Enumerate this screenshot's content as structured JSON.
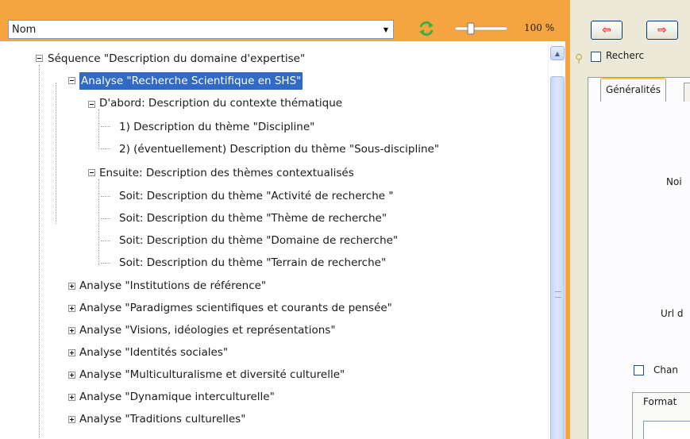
{
  "toolbar": {
    "field_value": "Nom",
    "zoom_value": "100 %"
  },
  "tree": {
    "root": "Séquence \"Description du domaine d'expertise\"",
    "selected": "Analyse \"Recherche Scientifique en SHS\"",
    "group1": "D'abord: Description du contexte thématique",
    "group1_items": [
      "1) Description du thème \"Discipline\"",
      "2) (éventuellement) Description du thème \"Sous-discipline\""
    ],
    "group2": "Ensuite: Description des thèmes contextualisés",
    "group2_items": [
      "Soit: Description du thème \"Activité de recherche \"",
      "Soit: Description du thème \"Thème de recherche\"",
      "Soit: Description du thème \"Domaine de recherche\"",
      "Soit: Description du thème \"Terrain de recherche\""
    ],
    "analyses": [
      "Analyse \"Institutions de référence\"",
      "Analyse \"Paradigmes scientifiques et courants de pensée\"",
      "Analyse \"Visions, idéologies et représentations\"",
      "Analyse \"Identités sociales\"",
      "Analyse \"Multiculturalisme et diversité culturelle\"",
      "Analyse \"Dynamique interculturelle\"",
      "Analyse \"Traditions culturelles\""
    ]
  },
  "right": {
    "search_label": "Recherc",
    "tab_general": "Généralités",
    "label_nom": "Noi",
    "label_url": "Url d",
    "checkbox_label": "Chan",
    "format_label": "Format"
  },
  "colors": {
    "toolbar_bg": "#f5a442",
    "selection": "#316ac5"
  },
  "icons": {
    "refresh": "refresh-icon",
    "back": "arrow-left-icon",
    "forward": "arrow-right-icon",
    "search": "magnifier-icon"
  }
}
